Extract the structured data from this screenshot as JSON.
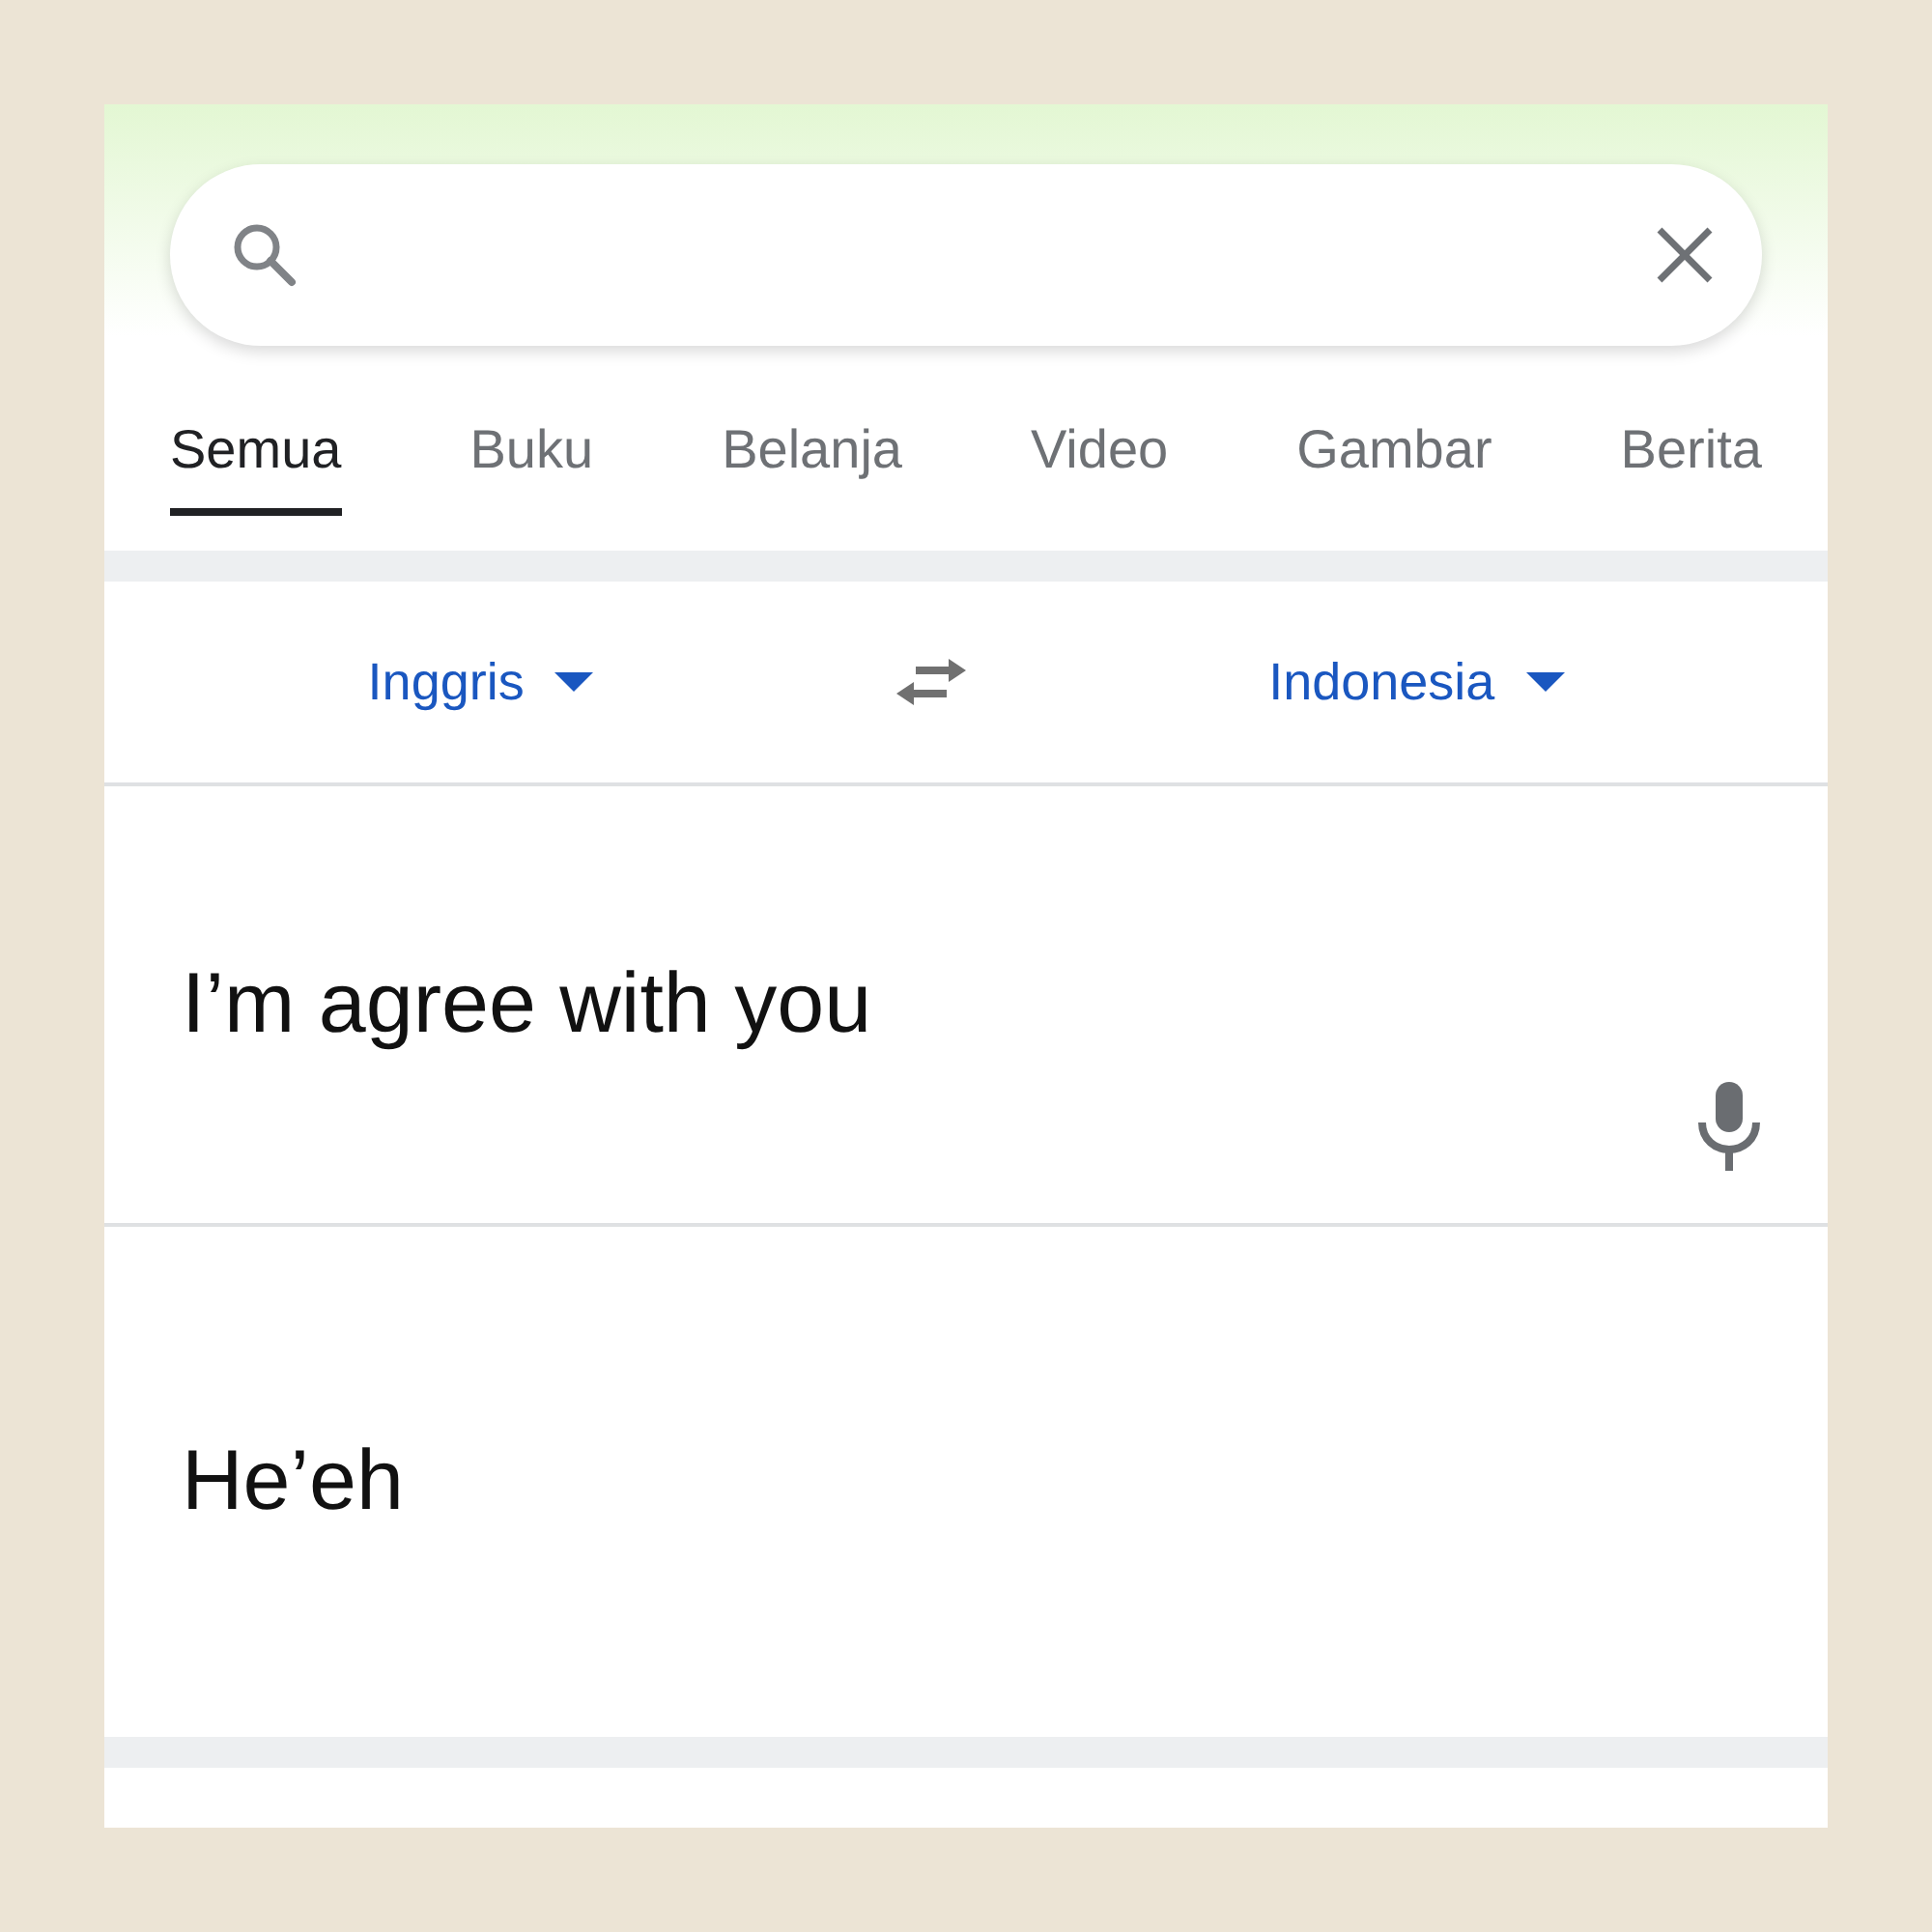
{
  "tabs": [
    {
      "label": "Semua",
      "selected": true
    },
    {
      "label": "Buku",
      "selected": false
    },
    {
      "label": "Belanja",
      "selected": false
    },
    {
      "label": "Video",
      "selected": false
    },
    {
      "label": "Gambar",
      "selected": false
    },
    {
      "label": "Berita",
      "selected": false
    }
  ],
  "translator": {
    "source_language": "Inggris",
    "target_language": "Indonesia",
    "source_text": "I’m agree with you",
    "translation": "He’eh"
  }
}
